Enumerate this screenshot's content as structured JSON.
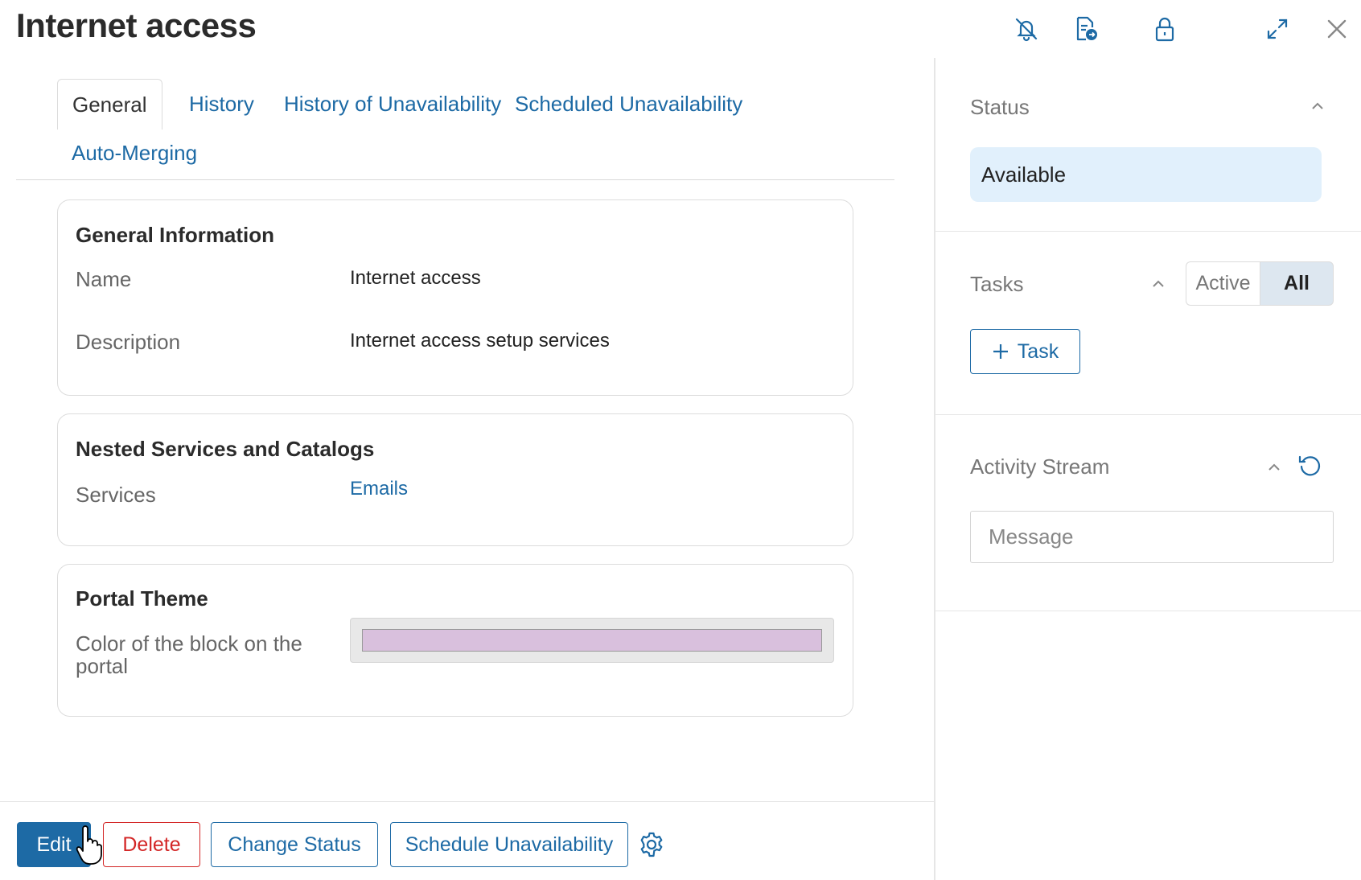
{
  "header": {
    "title": "Internet access"
  },
  "tabs": [
    {
      "label": "General",
      "active": true
    },
    {
      "label": "History"
    },
    {
      "label": "History of Unavailability"
    },
    {
      "label": "Scheduled Unavailability"
    },
    {
      "label": "Auto-Merging"
    }
  ],
  "general_info": {
    "title": "General Information",
    "name_label": "Name",
    "name_value": "Internet access",
    "description_label": "Description",
    "description_value": "Internet access setup services"
  },
  "nested": {
    "title": "Nested Services and Catalogs",
    "services_label": "Services",
    "services_value": "Emails"
  },
  "theme": {
    "title": "Portal Theme",
    "color_label": "Color of the block on the portal",
    "color_value": "#d9c0dd"
  },
  "footer": {
    "edit": "Edit",
    "delete": "Delete",
    "change_status": "Change Status",
    "schedule_unavailability": "Schedule Unavailability"
  },
  "status_panel": {
    "title": "Status",
    "value": "Available"
  },
  "tasks_panel": {
    "title": "Tasks",
    "filter_active": "Active",
    "filter_all": "All",
    "add_task": "Task"
  },
  "activity_panel": {
    "title": "Activity Stream",
    "message_placeholder": "Message"
  },
  "colors": {
    "accent": "#1d6aa5",
    "danger": "#d32626",
    "status_bg": "#e1f0fc"
  }
}
